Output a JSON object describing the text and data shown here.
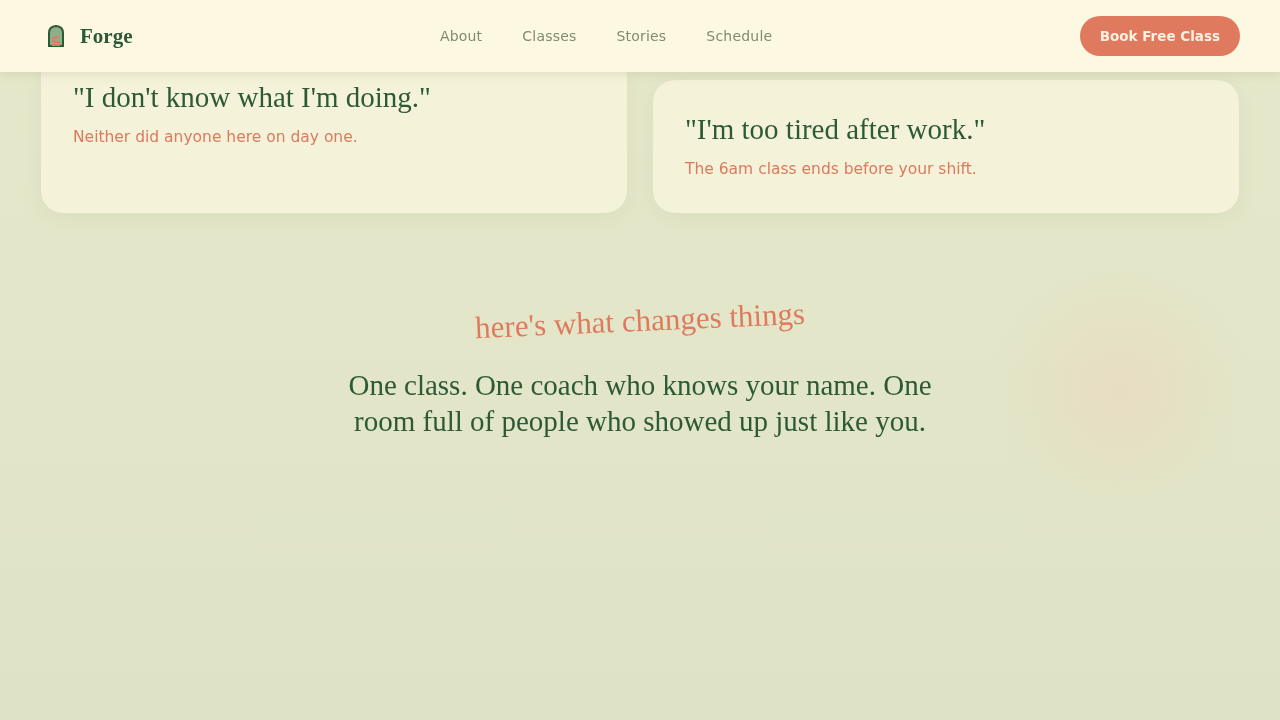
{
  "header": {
    "brand": "Forge",
    "nav": [
      {
        "label": "About"
      },
      {
        "label": "Classes"
      },
      {
        "label": "Stories"
      },
      {
        "label": "Schedule"
      }
    ],
    "cta": "Book Free Class"
  },
  "objections": [
    {
      "quote": "\"I don't know what I'm doing.\"",
      "answer": "Neither did anyone here on day one."
    },
    {
      "quote": "\"I'm too tired after work.\"",
      "answer": "The 6am class ends before your shift."
    }
  ],
  "turn": {
    "kicker": "here's what changes things",
    "statement": "One class. One coach who knows your name. One room full of people who showed up just like you."
  }
}
